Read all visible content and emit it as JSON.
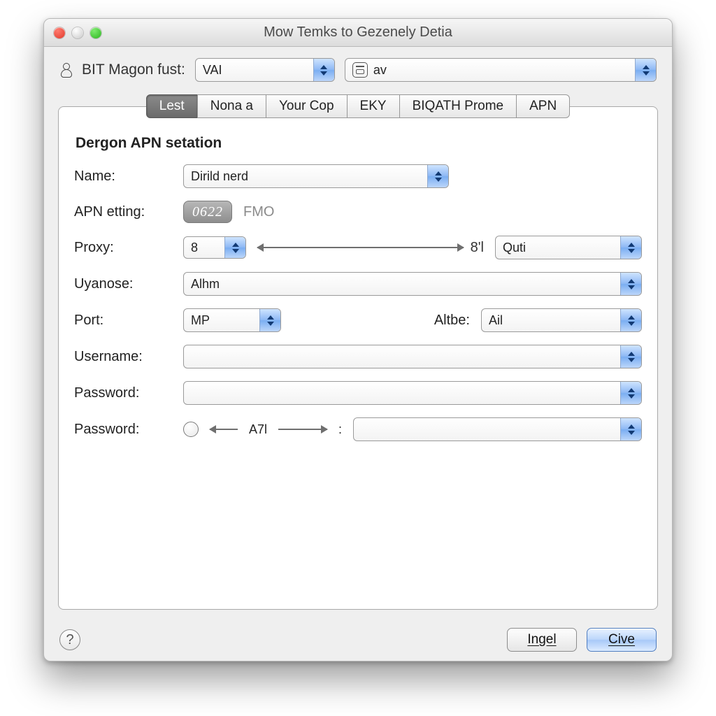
{
  "window": {
    "title": "Mow Temks to Gezenely Detia"
  },
  "topbar": {
    "label": "BIT Magon fust:",
    "primary_value": "VAI",
    "secondary_value": "av"
  },
  "tabs": [
    {
      "label": "Lest",
      "active": true
    },
    {
      "label": "Nona a",
      "active": false
    },
    {
      "label": "Your Cop",
      "active": false
    },
    {
      "label": "EKY",
      "active": false
    },
    {
      "label": "BIQATH Prome",
      "active": false
    },
    {
      "label": "APN",
      "active": false
    }
  ],
  "section": {
    "title": "Dergon APN setation"
  },
  "form": {
    "name": {
      "label": "Name:",
      "value": "Dirild nerd"
    },
    "apn_etting": {
      "label": "APN etting:",
      "badge": "0622",
      "suffix": "FMO"
    },
    "proxy": {
      "label": "Proxy:",
      "value": "8",
      "range_label": "8'l",
      "range_target": "Quti"
    },
    "uyanose": {
      "label": "Uyanose:",
      "value": "Alhm"
    },
    "port": {
      "label": "Port:",
      "value": "MP",
      "alt_label": "Altbe:",
      "alt_value": "Ail"
    },
    "username": {
      "label": "Username:",
      "value": ""
    },
    "password1": {
      "label": "Password:",
      "value": ""
    },
    "password2": {
      "label": "Password:",
      "slider_text": "A7l",
      "colon": ":",
      "value": ""
    }
  },
  "footer": {
    "help": "?",
    "cancel": "Ingel",
    "ok": "Cive"
  }
}
